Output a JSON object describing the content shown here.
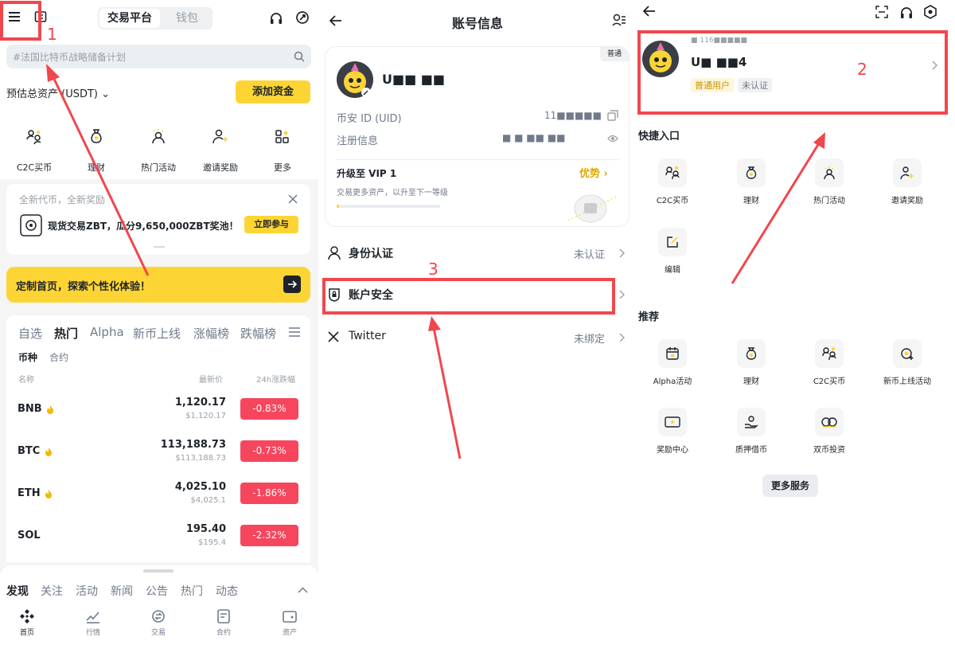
{
  "panel1": {
    "header": {
      "tab_active": "交易平台",
      "tab_inactive": "钱包"
    },
    "search_placeholder": "#法国比特币战略储备计划",
    "assets_label": "预估总资产 (USDT)",
    "add_funds": "添加资金",
    "quick": [
      {
        "label": "C2C买币",
        "icon": "c2c-icon"
      },
      {
        "label": "理财",
        "icon": "money-bag-icon"
      },
      {
        "label": "热门活动",
        "icon": "hot-activity-icon"
      },
      {
        "label": "邀请奖励",
        "icon": "invite-icon"
      },
      {
        "label": "更多",
        "icon": "more-grid-icon"
      }
    ],
    "promo": {
      "title": "全新代币，全新奖励",
      "text": "现货交易ZBT，瓜分9,650,000ZBT奖池！",
      "button": "立即参与"
    },
    "customize": "定制首页，探索个性化体验！",
    "market_tabs": [
      "自选",
      "热门",
      "Alpha",
      "新币上线",
      "涨幅榜",
      "跌幅榜"
    ],
    "sub_tabs": [
      "币种",
      "合约"
    ],
    "columns": [
      "名称",
      "最新价",
      "24h涨跌幅"
    ],
    "coins": [
      {
        "name": "BNB",
        "price": "1,120.17",
        "fiat": "$1,120.17",
        "change": "-0.83%"
      },
      {
        "name": "BTC",
        "price": "113,188.73",
        "fiat": "$113,188.73",
        "change": "-0.73%"
      },
      {
        "name": "ETH",
        "price": "4,025.10",
        "fiat": "$4,025.1",
        "change": "-1.86%"
      },
      {
        "name": "SOL",
        "price": "195.40",
        "fiat": "$195.4",
        "change": "-2.32%"
      }
    ],
    "feed_tabs": [
      "发现",
      "关注",
      "活动",
      "新闻",
      "公告",
      "热门",
      "动态"
    ],
    "nav": [
      "首页",
      "行情",
      "交易",
      "合约",
      "资产"
    ],
    "annotation": "1"
  },
  "panel2": {
    "title": "账号信息",
    "tag": "普通",
    "username": "U■■ ■■",
    "uid_label": "币安 ID (UID)",
    "uid_value": "11■■■■■",
    "reg_label": "注册信息",
    "reg_value": "■ ■ ■■ ■■",
    "vip_title": "升级至 VIP 1",
    "vip_sub": "交易更多资产，以升至下一等级",
    "vip_link": "优势",
    "vip_progress": 0.02,
    "rows": [
      {
        "label": "身份认证",
        "value": "未认证"
      },
      {
        "label": "账户安全",
        "value": ""
      },
      {
        "label": "Twitter",
        "value": "未绑定"
      }
    ],
    "annotation": "3"
  },
  "panel3": {
    "uid_small": "■ 116■■■■■",
    "username": "U■ ■■4",
    "badge_user": "普通用户",
    "badge_unverified": "未认证",
    "annotation": "2",
    "quick_title": "快捷入口",
    "quick": [
      {
        "label": "C2C买币",
        "icon": "c2c-icon"
      },
      {
        "label": "理财",
        "icon": "money-bag-icon"
      },
      {
        "label": "热门活动",
        "icon": "hot-activity-icon"
      },
      {
        "label": "邀请奖励",
        "icon": "invite-icon"
      },
      {
        "label": "编辑",
        "icon": "edit-icon"
      }
    ],
    "rec_title": "推荐",
    "rec": [
      {
        "label": "Alpha活动",
        "icon": "alpha-icon"
      },
      {
        "label": "理财",
        "icon": "money-bag-icon"
      },
      {
        "label": "C2C买币",
        "icon": "c2c-icon"
      },
      {
        "label": "新币上线活动",
        "icon": "new-coin-icon"
      },
      {
        "label": "奖励中心",
        "icon": "reward-icon"
      },
      {
        "label": "质押借币",
        "icon": "loan-icon"
      },
      {
        "label": "双币投资",
        "icon": "dual-invest-icon"
      }
    ],
    "more": "更多服务"
  },
  "colors": {
    "brand_yellow": "#fcd535",
    "down_red": "#f6465d",
    "annotation_red": "#f0474d"
  }
}
